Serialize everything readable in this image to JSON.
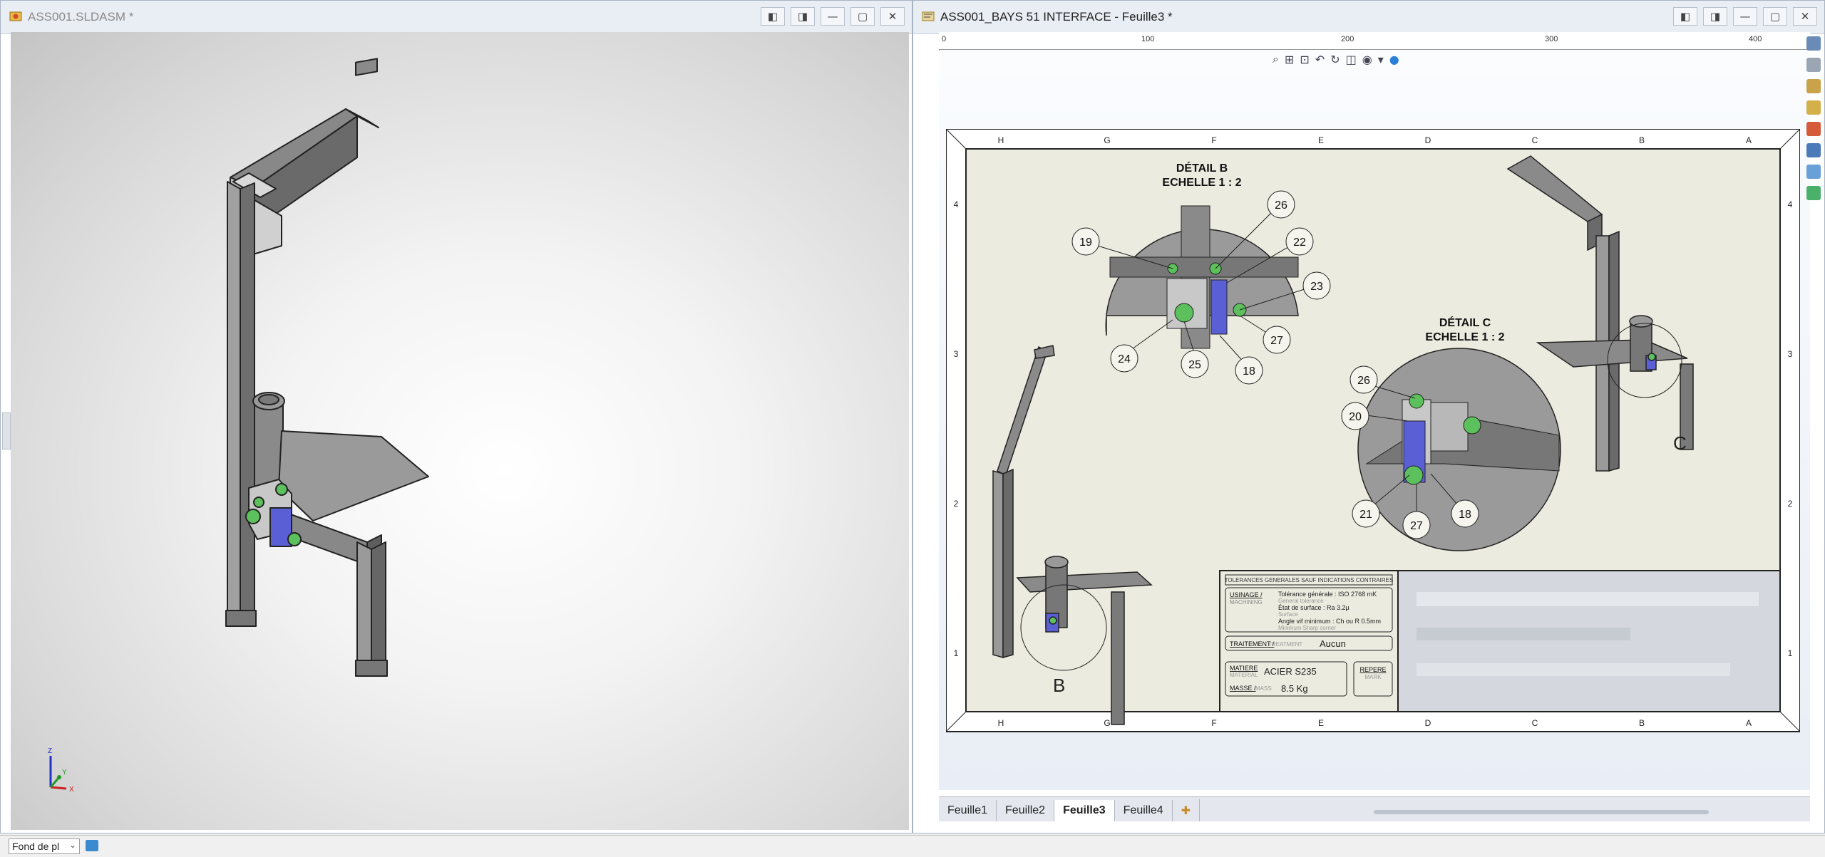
{
  "left_window": {
    "title": "ASS001.SLDASM *",
    "buttons": [
      "◧",
      "◨",
      "—",
      "▢",
      "✕"
    ]
  },
  "triad": {
    "z": "Z",
    "y": "Y",
    "x": "X"
  },
  "right_window": {
    "title": "ASS001_BAYS 51 INTERFACE - Feuille3 *",
    "buttons": [
      "◧",
      "◨",
      "—",
      "▢",
      "✕"
    ],
    "ruler_labels": [
      "0",
      "100",
      "200",
      "300",
      "400"
    ],
    "zones_letters": [
      "H",
      "G",
      "F",
      "E",
      "D",
      "C",
      "B",
      "A"
    ],
    "zones_numbers": [
      "4",
      "3",
      "2",
      "1"
    ],
    "detail_b": {
      "title": "DÉTAIL B",
      "scale": "ECHELLE 1 : 2",
      "label": "B",
      "balloons": [
        "19",
        "26",
        "22",
        "23",
        "27",
        "18",
        "25",
        "24"
      ]
    },
    "detail_c": {
      "title": "DÉTAIL C",
      "scale": "ECHELLE 1 : 2",
      "label": "C",
      "balloons": [
        "26",
        "20",
        "21",
        "27",
        "18"
      ]
    },
    "title_block": {
      "tolerances": "TOLERANCES GENERALES SAUF INDICATIONS CONTRAIRES",
      "usinage": "USINAGE /",
      "machining": "MACHINING",
      "tol_gen": "Tolérance générale : ISO 2768 mK",
      "tol_gen_en": "General tolerance",
      "etat": "État de surface     : Ra 3.2µ",
      "etat_en": "Surface",
      "angle": "Angle vif minimum    : Ch ou R 0.5mm",
      "angle_en": "Minimum Sharp corner",
      "traitement": "TRAITEMENT /",
      "treatment": "TREATMENT",
      "traitement_value": "Aucun",
      "matiere": "MATIERE",
      "material": "MATERIAL",
      "matiere_value": "ACIER S235",
      "masse": "MASSE /",
      "mass": "MASS",
      "masse_value": "8.5   Kg",
      "repere": "REPERE",
      "repere_en": "MARK"
    },
    "sheet_tabs": [
      "Feuille1",
      "Feuille2",
      "Feuille3",
      "Feuille4"
    ],
    "active_tab": "Feuille3"
  },
  "status": {
    "combo_value": "Fond de pl"
  }
}
